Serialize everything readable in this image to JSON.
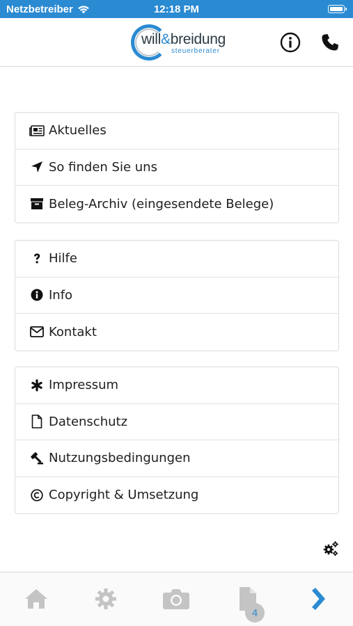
{
  "status_bar": {
    "carrier": "Netzbetreiber",
    "time": "12:18 PM"
  },
  "header": {
    "logo_name_a": "will",
    "logo_amp": "&",
    "logo_name_b": "breidung",
    "logo_sub": "steuerberater"
  },
  "groups": [
    {
      "items": [
        {
          "label": "Aktuelles",
          "icon": "newspaper-icon"
        },
        {
          "label": "So finden Sie uns",
          "icon": "location-arrow-icon"
        },
        {
          "label": "Beleg-Archiv (eingesendete Belege)",
          "icon": "archive-box-icon"
        }
      ]
    },
    {
      "items": [
        {
          "label": "Hilfe",
          "icon": "question-icon"
        },
        {
          "label": "Info",
          "icon": "info-circle-icon"
        },
        {
          "label": "Kontakt",
          "icon": "envelope-icon"
        }
      ]
    },
    {
      "items": [
        {
          "label": "Impressum",
          "icon": "asterisk-icon"
        },
        {
          "label": "Datenschutz",
          "icon": "document-icon"
        },
        {
          "label": "Nutzungsbedingungen",
          "icon": "gavel-icon"
        },
        {
          "label": "Copyright & Umsetzung",
          "icon": "copyright-icon"
        }
      ]
    }
  ],
  "tab_bar": {
    "documents_badge": "4"
  },
  "colors": {
    "accent": "#2a8ad2",
    "inactive_tab": "#c4c4c4"
  }
}
